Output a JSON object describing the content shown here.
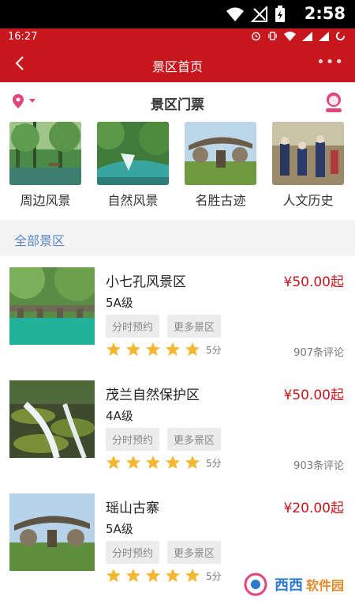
{
  "outer_status": {
    "time": "2:58"
  },
  "inner_status": {
    "time": "16:27"
  },
  "navbar": {
    "title": "景区首页",
    "more": "•••"
  },
  "subheader": {
    "title": "景区门票"
  },
  "categories": [
    {
      "label": "周边风景"
    },
    {
      "label": "自然风景"
    },
    {
      "label": "名胜古迹"
    },
    {
      "label": "人文历史"
    }
  ],
  "section": {
    "all_label": "全部景区"
  },
  "items": [
    {
      "name": "小七孔风景区",
      "price": "¥50.00起",
      "level": "5A级",
      "tag1": "分时预约",
      "tag2": "更多景区",
      "score": "5分",
      "reviews": "907条评论",
      "rating": 5
    },
    {
      "name": "茂兰自然保护区",
      "price": "¥50.00起",
      "level": "4A级",
      "tag1": "分时预约",
      "tag2": "更多景区",
      "score": "5分",
      "reviews": "903条评论",
      "rating": 5
    },
    {
      "name": "瑶山古寨",
      "price": "¥20.00起",
      "level": "5A级",
      "tag1": "分时预约",
      "tag2": "更多景区",
      "score": "5分",
      "reviews": "",
      "rating": 5
    }
  ],
  "watermark": {
    "text1": "西西",
    "text2": "软件园"
  },
  "colors": {
    "brand": "#c8161d",
    "link": "#5a87c6",
    "star": "#f5b731"
  }
}
